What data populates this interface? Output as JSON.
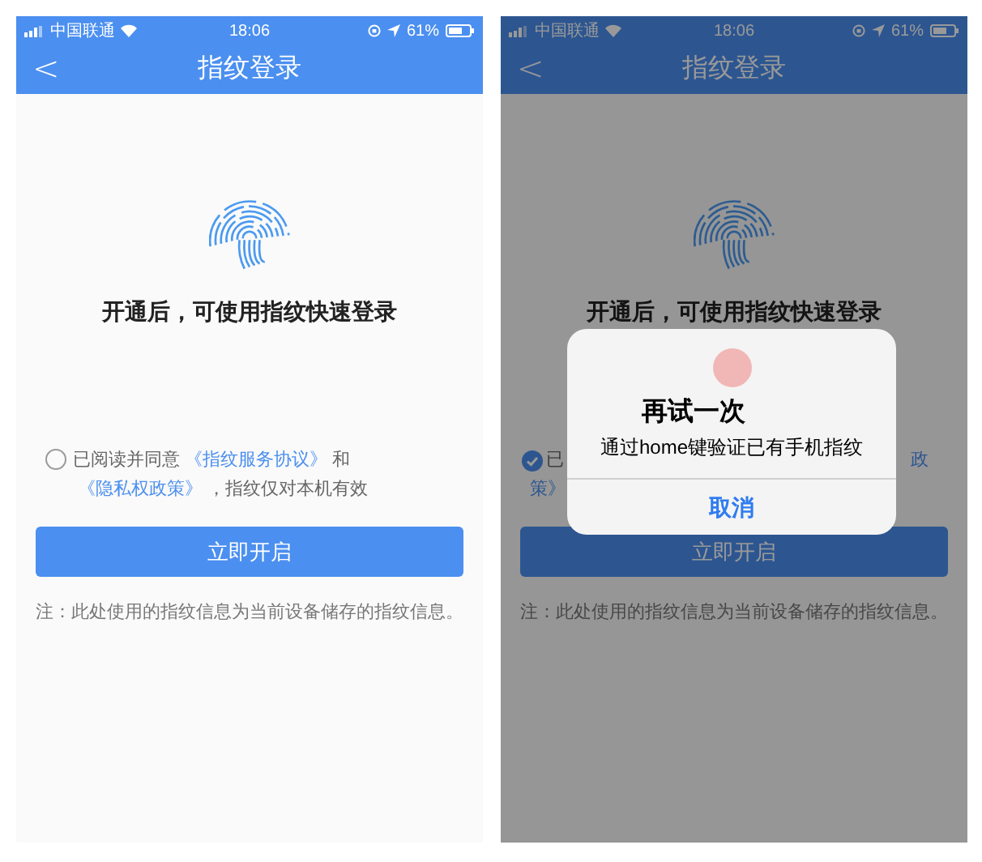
{
  "screens": [
    {
      "status_bar": {
        "carrier": "中国联通",
        "time": "18:06",
        "battery": "61%"
      },
      "title": "指纹登录",
      "back": "<",
      "subtitle": "开通后，可使用指纹快速登录",
      "agreement": {
        "checked": false,
        "segments": [
          {
            "kind": "text",
            "text": "已阅读并同意"
          },
          {
            "kind": "link",
            "text": "《指纹服务协议》"
          },
          {
            "kind": "text",
            "text": "和"
          },
          {
            "kind": "link",
            "text": "《隐私权政策》"
          },
          {
            "kind": "text",
            "text": "，指纹仅对本机有效"
          }
        ]
      },
      "button": "立即开启",
      "note": "注：此处使用的指纹信息为当前设备储存的指纹信息。"
    },
    {
      "status_bar": {
        "carrier": "中国联通",
        "time": "18:06",
        "battery": "61%"
      },
      "title": "指纹登录",
      "back": "<",
      "subtitle": "开通后，可使用指纹快速登录",
      "agreement_fragments": {
        "checked": true,
        "line1_start": "已",
        "line1_end": "政",
        "line2_start": "策》"
      },
      "button": "立即开启",
      "note": "注：此处使用的指纹信息为当前设备储存的指纹信息。",
      "dialog": {
        "title": "再试一次",
        "message": "通过home键验证已有手机指纹",
        "cancel": "取消"
      }
    }
  ]
}
